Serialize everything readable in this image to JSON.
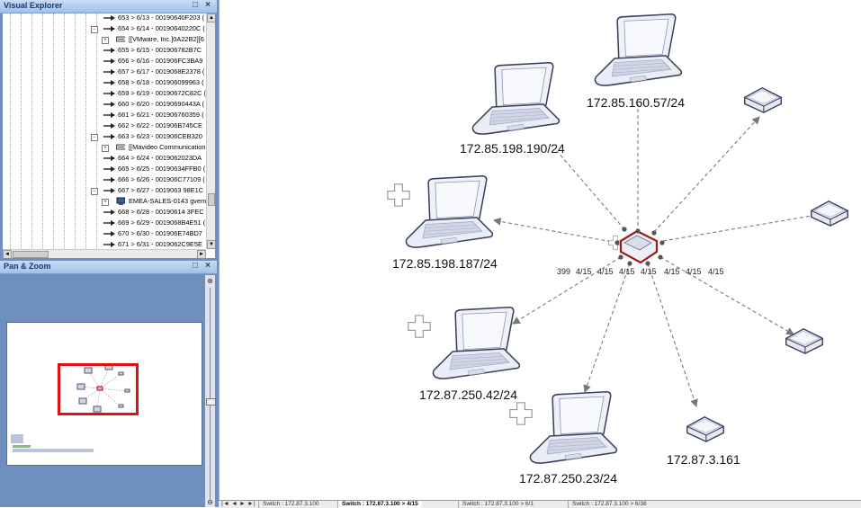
{
  "visual_explorer": {
    "title": "Visual Explorer",
    "rows": [
      {
        "indent": 0,
        "type": "arrow",
        "text": "653 > 6/13 - 00190640F203 ("
      },
      {
        "indent": -1,
        "type": "arrow",
        "expander": "−",
        "text": "654 > 6/14 - 00190640220C ("
      },
      {
        "indent": 1,
        "type": "device",
        "expander": "+",
        "text": "[[VMware, Inc.]0A22B2][6"
      },
      {
        "indent": 0,
        "type": "arrow",
        "text": "655 > 6/15 - 001906782B7C"
      },
      {
        "indent": 0,
        "type": "arrow",
        "text": "656 > 6/16 - 001906FC3BA9"
      },
      {
        "indent": 0,
        "type": "arrow",
        "text": "657 > 6/17 - 0019068E2378 ("
      },
      {
        "indent": 0,
        "type": "arrow",
        "text": "658 > 6/18 - 001906099963 ("
      },
      {
        "indent": 0,
        "type": "arrow",
        "text": "659 > 6/19 - 00190672C82C ("
      },
      {
        "indent": 0,
        "type": "arrow",
        "text": "660 > 6/20 - 00190690443A ("
      },
      {
        "indent": 0,
        "type": "arrow",
        "text": "661 > 6/21 - 001906760359 ("
      },
      {
        "indent": 0,
        "type": "arrow",
        "text": "662 > 6/22 - 001906B745CE"
      },
      {
        "indent": -1,
        "type": "arrow",
        "expander": "−",
        "text": "663 > 6/23 - 001906CEB320"
      },
      {
        "indent": 1,
        "type": "device",
        "expander": "+",
        "text": "[[Mavideo Communication"
      },
      {
        "indent": 0,
        "type": "arrow",
        "text": "664 > 6/24 - 0019062023DA"
      },
      {
        "indent": 0,
        "type": "arrow",
        "text": "665 > 6/25 - 00190634FFB0 ("
      },
      {
        "indent": 0,
        "type": "arrow",
        "text": "666 > 6/26 - 001906C77109 ("
      },
      {
        "indent": -1,
        "type": "arrow",
        "expander": "−",
        "text": "667 > 6/27 - 0019063 98E1C"
      },
      {
        "indent": 1,
        "type": "pc",
        "expander": "+",
        "text": "EMEA-SALES-0143 gvem"
      },
      {
        "indent": 0,
        "type": "arrow",
        "text": "668 > 6/28 - 00190614 3FEC ("
      },
      {
        "indent": 0,
        "type": "arrow",
        "text": "669 > 6/29 - 0019068B4E51 ("
      },
      {
        "indent": 0,
        "type": "arrow",
        "text": "670 > 6/30 - 001906E74BD7"
      },
      {
        "indent": 0,
        "type": "arrow",
        "text": "671 > 6/31 - 0019062C9E5E"
      }
    ]
  },
  "pan_zoom": {
    "title": "Pan & Zoom"
  },
  "panel_buttons": {
    "restore": "□",
    "close": "×"
  },
  "center_switch": {
    "edge_labels": [
      "399",
      "4/15",
      "4/15",
      "4/15",
      "4/15",
      "4/15",
      "4/15",
      "4/15"
    ]
  },
  "nodes": {
    "laptop_top": "172.85.160.57/24",
    "laptop_upper_left": "172.85.198.190/24",
    "laptop_left": "172.85.198.187/24",
    "laptop_lower_left": "172.87.250.42/24",
    "laptop_bottom": "172.87.250.23/24",
    "switch_bottom_right": "172.87.3.161"
  },
  "tabs": {
    "nav": [
      "|◄",
      "◄",
      "►",
      "►|"
    ],
    "items": [
      {
        "label": "Switch : 172.87.3.100",
        "active": false
      },
      {
        "label": "Switch : 172.87.3.100 > 4/15",
        "active": true
      },
      {
        "label": "Switch : 172.87.3.100 > 6/1",
        "active": false
      },
      {
        "label": "Switch : 172.87.3.100 > 6/38",
        "active": false
      }
    ]
  },
  "colors": {
    "panel_bg": "#6f8fc0",
    "title_bg": "#b6cdf0",
    "selection_red": "#e01010",
    "switch_outline": "#a01818"
  }
}
